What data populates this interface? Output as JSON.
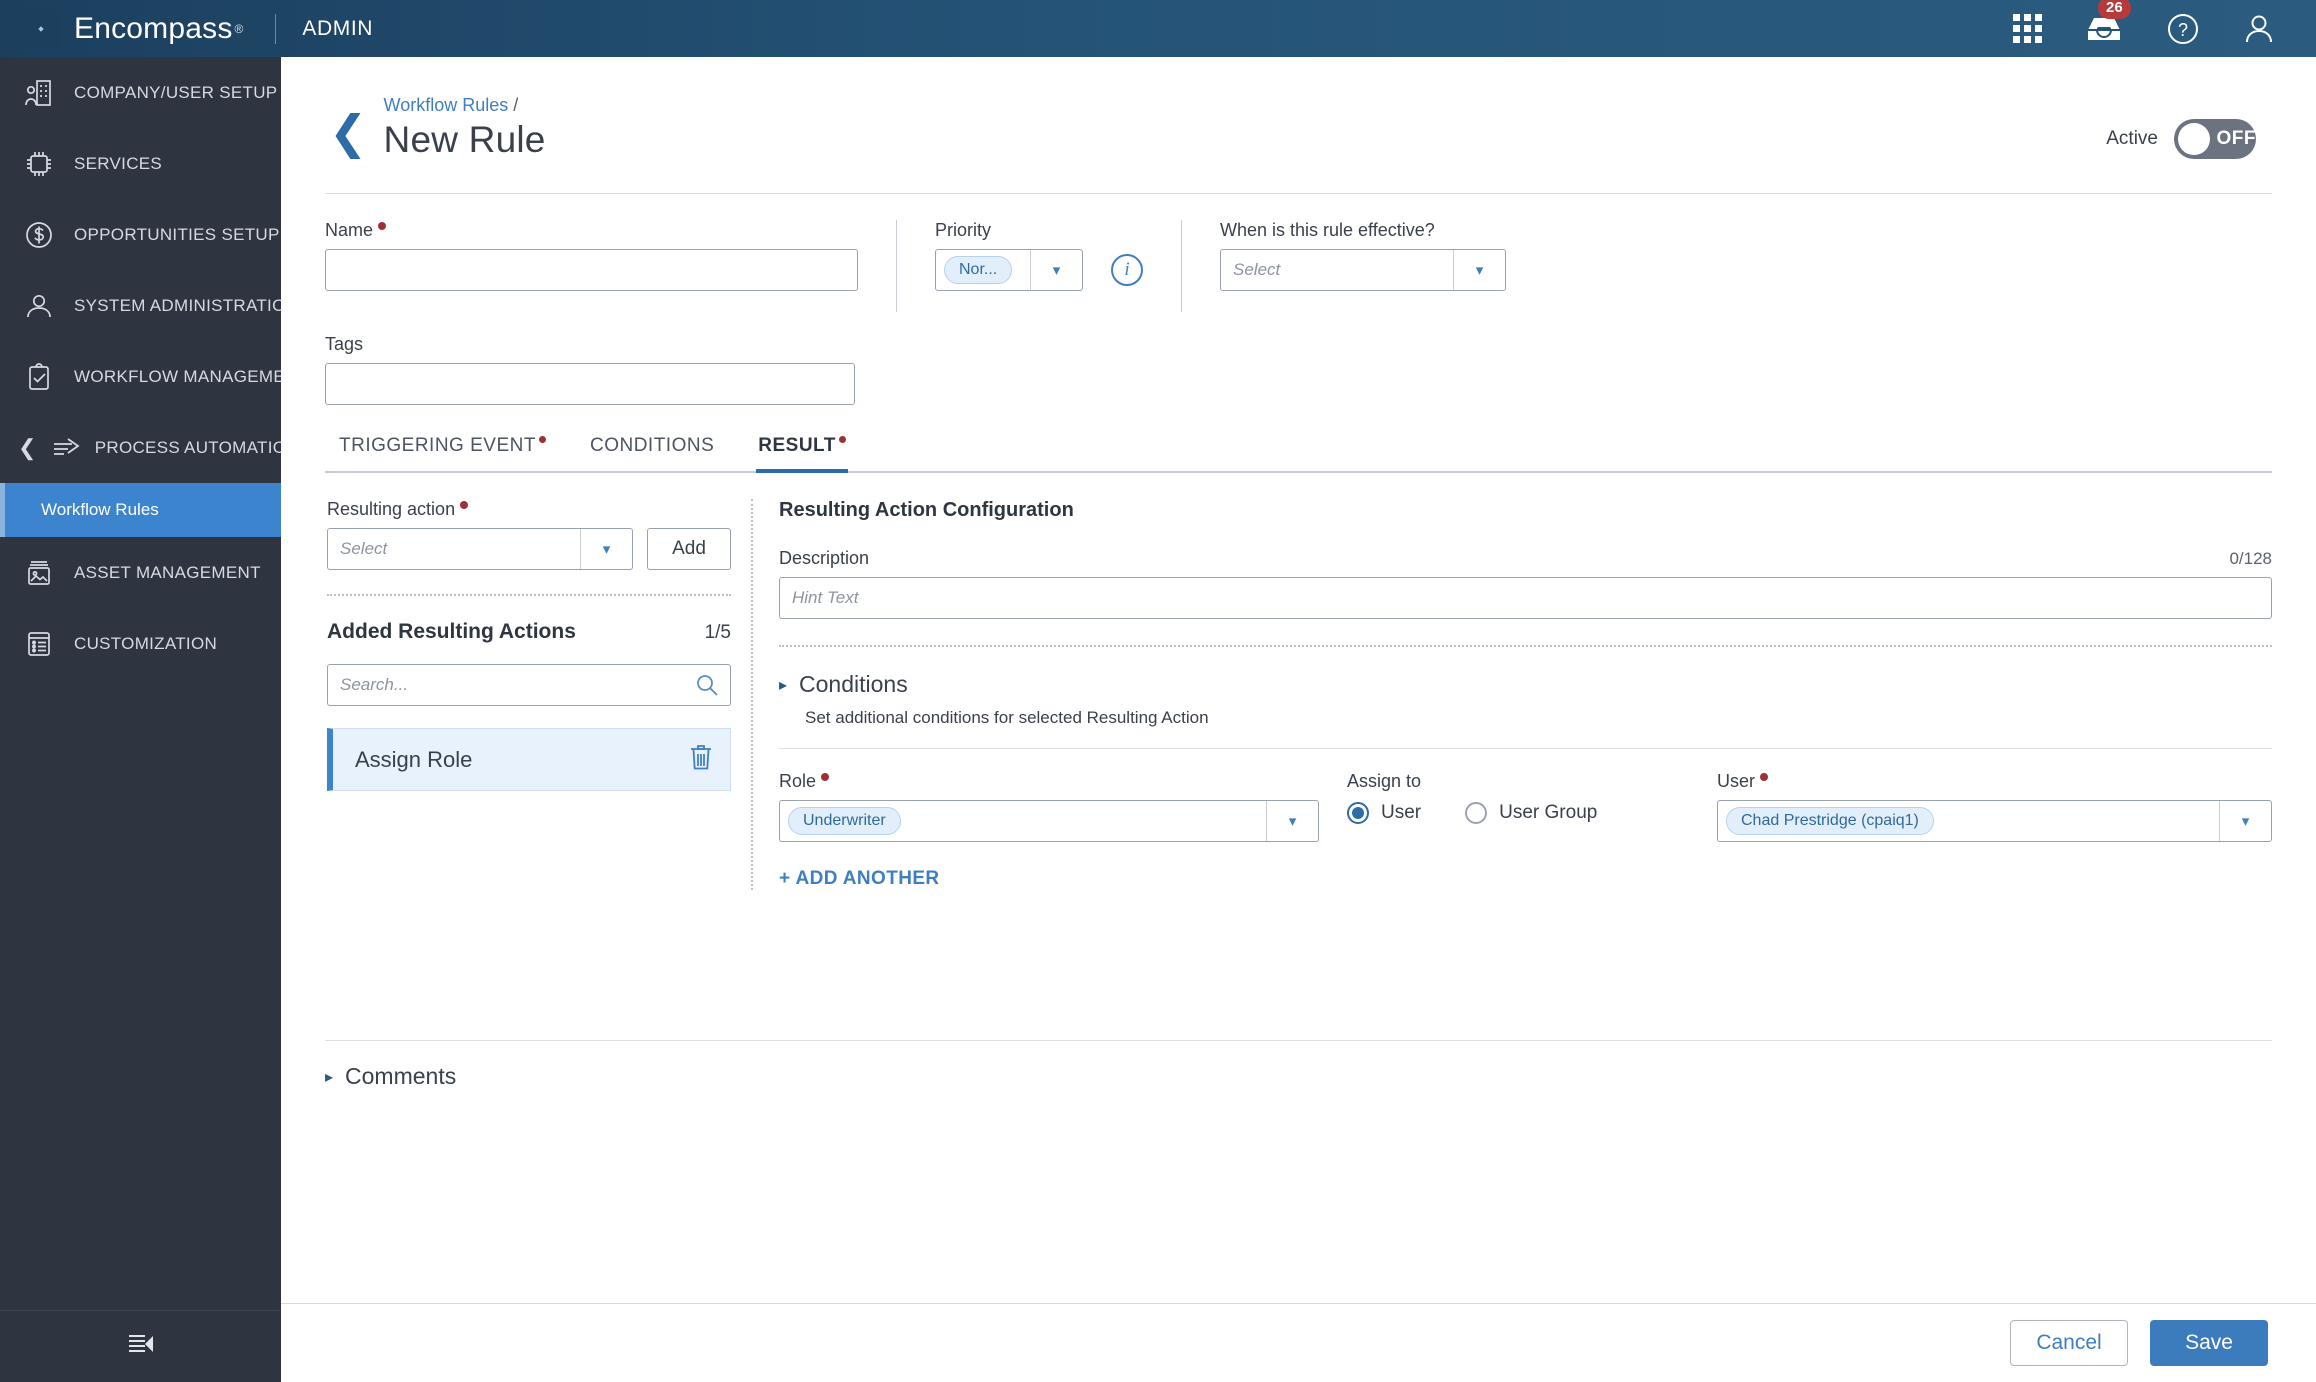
{
  "topbar": {
    "brand": "Encompass",
    "brand_reg": "®",
    "section": "ADMIN",
    "icons": {
      "apps": "apps-grid-icon",
      "inbox": "inbox-tray-icon",
      "help": "help-circle-icon",
      "account": "user-account-icon"
    },
    "inbox_badge": "26"
  },
  "sidebar": {
    "items": [
      {
        "label": "COMPANY/USER SETUP",
        "icon": "company-building-icon"
      },
      {
        "label": "SERVICES",
        "icon": "chip-services-icon"
      },
      {
        "label": "OPPORTUNITIES SETUP",
        "icon": "dollar-circle-icon"
      },
      {
        "label": "SYSTEM ADMINISTRATION",
        "icon": "user-person-icon"
      },
      {
        "label": "WORKFLOW MANAGEMENT",
        "icon": "clipboard-check-icon"
      },
      {
        "label": "PROCESS AUTOMATION",
        "icon": "arrow-flow-icon",
        "expanded": true
      },
      {
        "label": "ASSET MANAGEMENT",
        "icon": "image-asset-icon"
      },
      {
        "label": "CUSTOMIZATION",
        "icon": "list-document-icon"
      }
    ],
    "subitem": "Workflow Rules",
    "collapse_icon": "collapse-panel-icon"
  },
  "header": {
    "breadcrumb": "Workflow Rules",
    "breadcrumb_separator": "/",
    "title": "New Rule",
    "back_icon": "back-chevron-icon",
    "active_label": "Active",
    "toggle_state": "OFF"
  },
  "form": {
    "name": {
      "label": "Name",
      "value": "",
      "placeholder": "",
      "required": true
    },
    "priority": {
      "label": "Priority",
      "value": "Nor...",
      "required": false,
      "info_icon": "info-circle-icon"
    },
    "effective": {
      "label": "When is this rule effective?",
      "placeholder": "Select",
      "value": ""
    },
    "tags": {
      "label": "Tags",
      "value": "",
      "placeholder": ""
    }
  },
  "tabs": [
    {
      "label": "TRIGGERING EVENT",
      "required": true,
      "active": false
    },
    {
      "label": "CONDITIONS",
      "required": false,
      "active": false
    },
    {
      "label": "RESULT",
      "required": true,
      "active": true
    }
  ],
  "result_tab": {
    "resulting_action": {
      "label": "Resulting action",
      "placeholder": "Select",
      "add_button": "Add"
    },
    "added": {
      "title": "Added Resulting Actions",
      "count": "1/5",
      "search_placeholder": "Search...",
      "search_icon": "search-icon",
      "items": [
        {
          "name": "Assign Role",
          "selected": true,
          "delete_icon": "trash-icon"
        }
      ]
    },
    "config": {
      "title": "Resulting Action Configuration",
      "description": {
        "label": "Description",
        "counter": "0/128",
        "placeholder": "Hint Text",
        "value": ""
      },
      "conditions": {
        "title": "Conditions",
        "subtitle": "Set additional conditions for selected Resulting Action",
        "caret_icon": "caret-right-icon"
      },
      "role": {
        "label": "Role",
        "value": "Underwriter",
        "required": true
      },
      "assign_to": {
        "label": "Assign to",
        "options": [
          {
            "label": "User",
            "selected": true
          },
          {
            "label": "User Group",
            "selected": false
          }
        ]
      },
      "user": {
        "label": "User",
        "value": "Chad Prestridge (cpaiq1)",
        "required": true
      },
      "add_another": "+ ADD ANOTHER"
    }
  },
  "comments": {
    "title": "Comments",
    "caret_icon": "caret-right-icon"
  },
  "footer": {
    "cancel": "Cancel",
    "save": "Save"
  },
  "colors": {
    "topbar": "#245377",
    "sidebar": "#2e3440",
    "accent_blue": "#3d84ce",
    "link_blue": "#3f7fc1",
    "required_red": "#9e3138",
    "badge_red": "#b73a3a",
    "save_blue": "#3d7cbc"
  }
}
